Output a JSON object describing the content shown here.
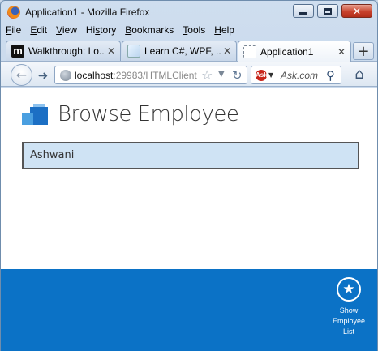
{
  "window": {
    "title": "Application1 - Mozilla Firefox",
    "controls": {
      "minimize": "minimize",
      "maximize": "maximize",
      "close": "✕"
    }
  },
  "menu": [
    {
      "accel": "F",
      "rest": "ile"
    },
    {
      "accel": "E",
      "rest": "dit"
    },
    {
      "accel": "V",
      "rest": "iew"
    },
    {
      "accel": "",
      "rest": "Hi",
      "accel2": "s",
      "rest2": "tory"
    },
    {
      "accel": "B",
      "rest": "ookmarks"
    },
    {
      "accel": "T",
      "rest": "ools"
    },
    {
      "accel": "H",
      "rest": "elp"
    }
  ],
  "tabs": [
    {
      "label": "Walkthrough: Lo...",
      "close": "✕",
      "icon": "m-icon",
      "icon_text": "m"
    },
    {
      "label": "Learn C#, WPF, ...",
      "close": "✕",
      "icon": "learn-icon"
    },
    {
      "label": "Application1",
      "close": "✕",
      "icon": "blank-page-icon",
      "active": true
    }
  ],
  "new_tab": "+",
  "navigation": {
    "url_host": "localhost",
    "url_rest": ":29983/HTMLClient",
    "search_placeholder": "Ask.com",
    "ask_logo": "Ask"
  },
  "page": {
    "title": "Browse Employee",
    "items": [
      "Ashwani"
    ]
  },
  "command": {
    "label_line1": "Show",
    "label_line2": "Employee",
    "label_line3": "List",
    "icon": "star-icon"
  },
  "colors": {
    "command_bar": "#0b72c6",
    "list_item_bg": "#cfe3f4",
    "logo_blue": "#1c6fc4"
  }
}
